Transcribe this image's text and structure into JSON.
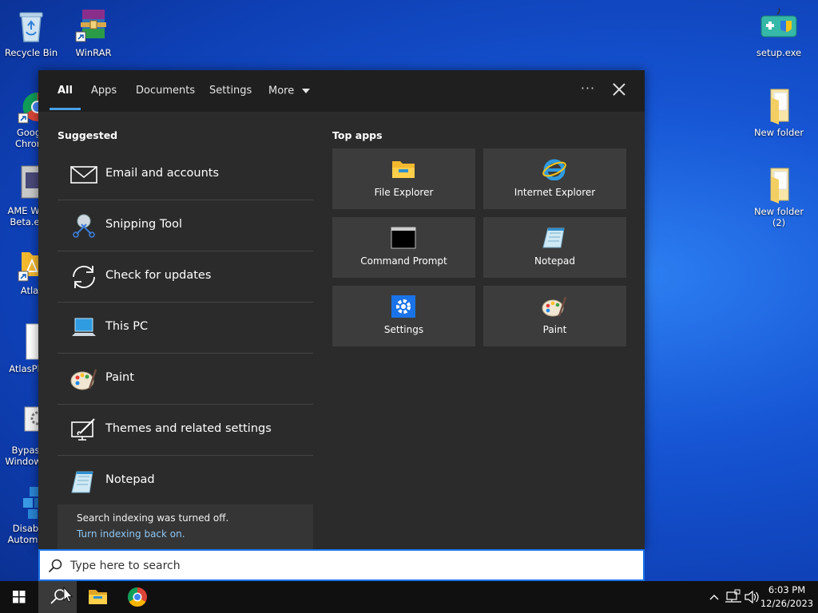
{
  "desktop": {
    "icons_left": [
      {
        "label": "Recycle Bin"
      },
      {
        "label": "WinRAR"
      },
      {
        "label": "Goog Chron"
      },
      {
        "label": "AME Wi Beta.e"
      },
      {
        "label": "Atla"
      },
      {
        "label": "AtlasPla"
      },
      {
        "label": "Bypas Windows"
      },
      {
        "label": "Disab Automa"
      }
    ],
    "icons_right": [
      {
        "label": "setup.exe"
      },
      {
        "label": "New folder"
      },
      {
        "label": "New folder (2)"
      }
    ]
  },
  "search_panel": {
    "tabs": [
      {
        "label": "All",
        "active": true
      },
      {
        "label": "Apps"
      },
      {
        "label": "Documents"
      },
      {
        "label": "Settings"
      },
      {
        "label": "More"
      }
    ],
    "more_options": "···",
    "suggested_title": "Suggested",
    "suggested": [
      {
        "label": "Email and accounts",
        "icon": "mail-icon"
      },
      {
        "label": "Snipping Tool",
        "icon": "snipping-tool-icon"
      },
      {
        "label": "Check for updates",
        "icon": "sync-icon"
      },
      {
        "label": "This PC",
        "icon": "computer-icon"
      },
      {
        "label": "Paint",
        "icon": "paint-palette-icon"
      },
      {
        "label": "Themes and related settings",
        "icon": "themes-icon"
      },
      {
        "label": "Notepad",
        "icon": "notepad-icon"
      }
    ],
    "indexing": {
      "message": "Search indexing was turned off.",
      "link": "Turn indexing back on."
    },
    "top_apps_title": "Top apps",
    "top_apps": [
      {
        "label": "File Explorer",
        "icon": "file-explorer-icon"
      },
      {
        "label": "Internet Explorer",
        "icon": "internet-explorer-icon"
      },
      {
        "label": "Command Prompt",
        "icon": "command-prompt-icon"
      },
      {
        "label": "Notepad",
        "icon": "notepad-icon"
      },
      {
        "label": "Settings",
        "icon": "settings-gear-icon"
      },
      {
        "label": "Paint",
        "icon": "paint-palette-icon"
      }
    ]
  },
  "search_box": {
    "placeholder": "Type here to search",
    "value": ""
  },
  "taskbar": {
    "clock_time": "6:03 PM",
    "clock_date": "12/26/2023"
  },
  "colors": {
    "accent": "#1a73e8",
    "panel_bg": "#2b2b2b",
    "tile_bg": "#3c3c3c",
    "link": "#8ec7f5"
  }
}
